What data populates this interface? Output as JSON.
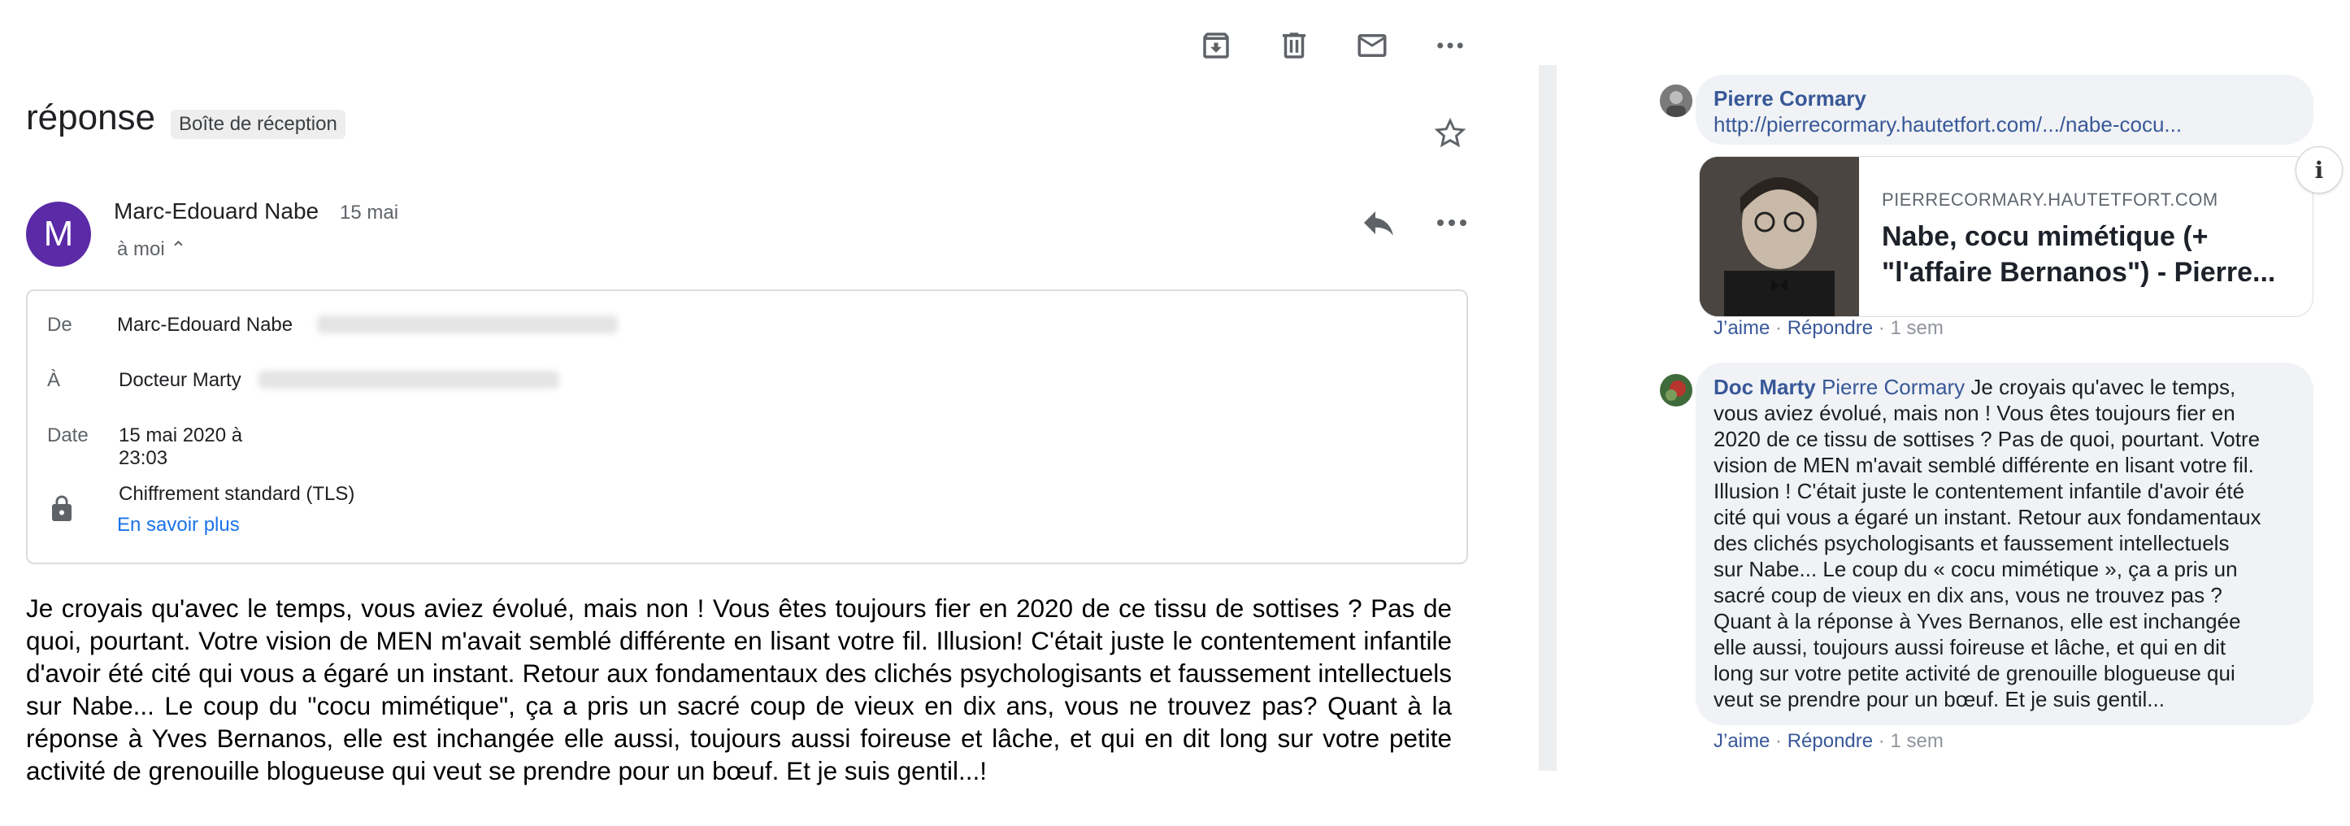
{
  "toolbar": {
    "archive_icon": "archive-icon",
    "delete_icon": "trash-icon",
    "mark_unread_icon": "envelope-icon",
    "more_icon": "more-horizontal-icon"
  },
  "message": {
    "subject": "réponse",
    "label": "Boîte de réception",
    "sender_initial": "M",
    "sender_name": "Marc-Edouard Nabe",
    "date_short": "15 mai",
    "recipient_summary": "à moi ⌃",
    "details": {
      "from_label": "De",
      "from_value": "Marc-Edouard Nabe",
      "to_label": "À",
      "to_value": "Docteur Marty",
      "date_label": "Date",
      "date_value_line1": "15 mai 2020 à",
      "date_value_line2": "23:03",
      "security_value": "Chiffrement standard (TLS)",
      "learn_more": "En savoir plus"
    },
    "body": "Je croyais qu'avec le temps, vous aviez évolué, mais non ! Vous êtes toujours fier en 2020 de ce tissu de sottises ? Pas de quoi, pourtant. Votre vision de MEN m'avait semblé différente en lisant votre fil. Illusion! C'était juste le contentement infantile d'avoir été cité qui vous a égaré un instant. Retour aux fondamentaux des clichés psychologisants et faussement intellectuels sur Nabe... Le coup du \"cocu mimétique\", ça a pris un sacré coup de vieux en dix ans, vous ne trouvez pas? Quant à la réponse à Yves Bernanos, elle est inchangée elle aussi, toujours aussi foireuse et lâche, et qui en dit long sur votre petite activité de grenouille blogueuse qui veut se prendre pour un bœuf. Et je suis gentil...!",
    "colors": {
      "avatar": "#5b2aa6",
      "link": "#1a73e8"
    }
  },
  "comments": [
    {
      "author": "Pierre Cormary",
      "link": "http://pierrecormary.hautetfort.com/.../nabe-cocu...",
      "card": {
        "domain": "PIERRECORMARY.HAUTETFORT.COM",
        "title_line1": "Nabe, cocu mimétique (+",
        "title_line2": "\"l'affaire Bernanos\") - Pierre..."
      },
      "like": "J’aime",
      "reply": "Répondre",
      "sep": "·",
      "time": "1 sem"
    },
    {
      "author": "Doc Marty",
      "mention": "Pierre Cormary",
      "lines": [
        " Je croyais qu'avec le temps,",
        "vous aviez évolué, mais non ! Vous êtes toujours fier en",
        "2020 de ce tissu de sottises ? Pas de quoi, pourtant. Votre",
        "vision de MEN m'avait semblé différente en lisant votre fil.",
        "Illusion ! C'était juste le contentement infantile d'avoir été",
        "cité qui vous a égaré un instant. Retour aux fondamentaux",
        "des clichés psychologisants et faussement intellectuels",
        "sur Nabe... Le coup du « cocu mimétique », ça a pris un",
        "sacré coup de vieux en dix ans, vous ne trouvez pas ?",
        "Quant à la réponse à Yves Bernanos, elle est inchangée",
        "elle aussi, toujours aussi foireuse et lâche, et qui en dit",
        "long sur votre petite activité de grenouille blogueuse qui",
        "veut se prendre pour un bœuf. Et je suis gentil..."
      ],
      "like": "J’aime",
      "reply": "Répondre",
      "sep": "·",
      "time": "1 sem"
    }
  ],
  "info_button": "i",
  "fb_colors": {
    "name": "#385898",
    "bubble": "#f0f2f5",
    "meta": "#90949c"
  }
}
